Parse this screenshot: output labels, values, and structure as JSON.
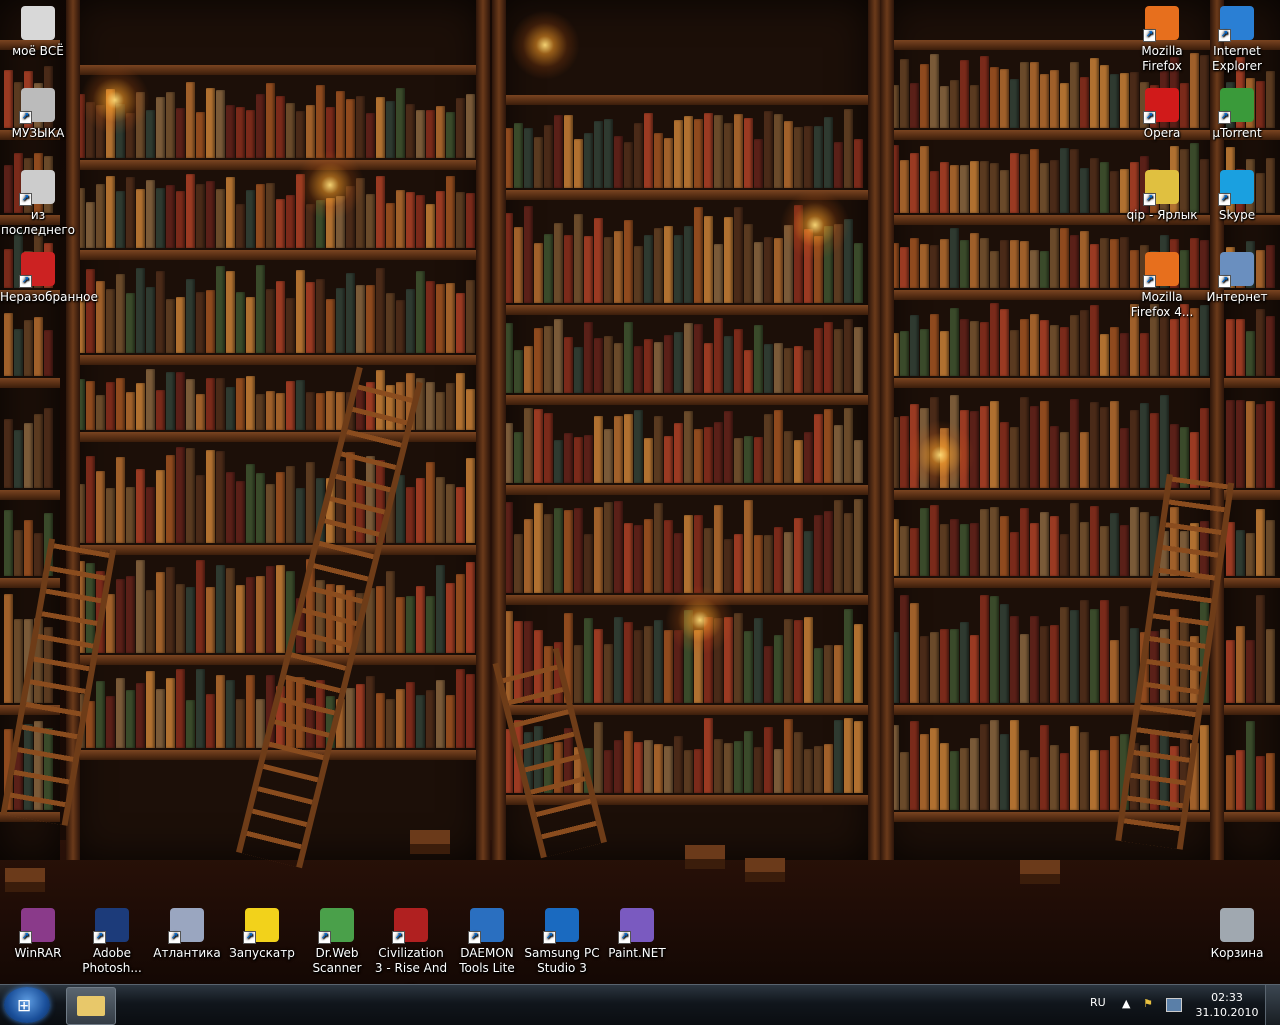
{
  "desktop_icons": [
    {
      "label": "моё ВСЁ",
      "icon": "folder-document-icon",
      "color": "#d8d8d8"
    },
    {
      "label": "МУЗЫКА",
      "icon": "speaker-icon",
      "color": "#bbbbbb"
    },
    {
      "label": "из последнего",
      "icon": "camera-icon",
      "color": "#cccccc"
    },
    {
      "label": "Неразобранное",
      "icon": "red-x-icon",
      "color": "#cc2222"
    },
    {
      "label": "Mozilla Firefox",
      "icon": "firefox-icon",
      "color": "#e76f1d"
    },
    {
      "label": "Internet Explorer",
      "icon": "internet-explorer-icon",
      "color": "#2a7fd4"
    },
    {
      "label": "Opera",
      "icon": "opera-icon",
      "color": "#d11a1a"
    },
    {
      "label": "µTorrent",
      "icon": "utorrent-icon",
      "color": "#3a9a3a"
    },
    {
      "label": "qip - Ярлык",
      "icon": "qip-icon",
      "color": "#e0c040"
    },
    {
      "label": "Skype",
      "icon": "skype-icon",
      "color": "#1aa0e0"
    },
    {
      "label": "Mozilla Firefox 4...",
      "icon": "firefox-icon",
      "color": "#e76f1d"
    },
    {
      "label": "Интернет",
      "icon": "network-icon",
      "color": "#6a8fbf"
    },
    {
      "label": "WinRAR",
      "icon": "winrar-icon",
      "color": "#8a3a8a"
    },
    {
      "label": "Adobe Photosh...",
      "icon": "photoshop-icon",
      "color": "#1c3b7a"
    },
    {
      "label": "Атлантика",
      "icon": "atlantica-icon",
      "color": "#9aa6c0"
    },
    {
      "label": "Запускатр",
      "icon": "launcher-icon",
      "color": "#f2d21b"
    },
    {
      "label": "Dr.Web Scanner",
      "icon": "drweb-icon",
      "color": "#4aa04a"
    },
    {
      "label": "Civilization 3 - Rise And ...",
      "icon": "civilization-icon",
      "color": "#b02020"
    },
    {
      "label": "DAEMON Tools Lite",
      "icon": "daemon-tools-icon",
      "color": "#2a6fc0"
    },
    {
      "label": "Samsung PC Studio 3",
      "icon": "samsung-icon",
      "color": "#1a6ac0"
    },
    {
      "label": "Paint.NET",
      "icon": "paint-net-icon",
      "color": "#7a5ac0"
    },
    {
      "label": "Корзина",
      "icon": "recycle-bin-icon",
      "color": "#a0a8b0"
    }
  ],
  "taskbar": {
    "language": "RU",
    "time": "02:33",
    "date": "31.10.2010",
    "start_glyph": "⊞",
    "tray_arrow": "▲",
    "tray_flag": "⚑"
  }
}
